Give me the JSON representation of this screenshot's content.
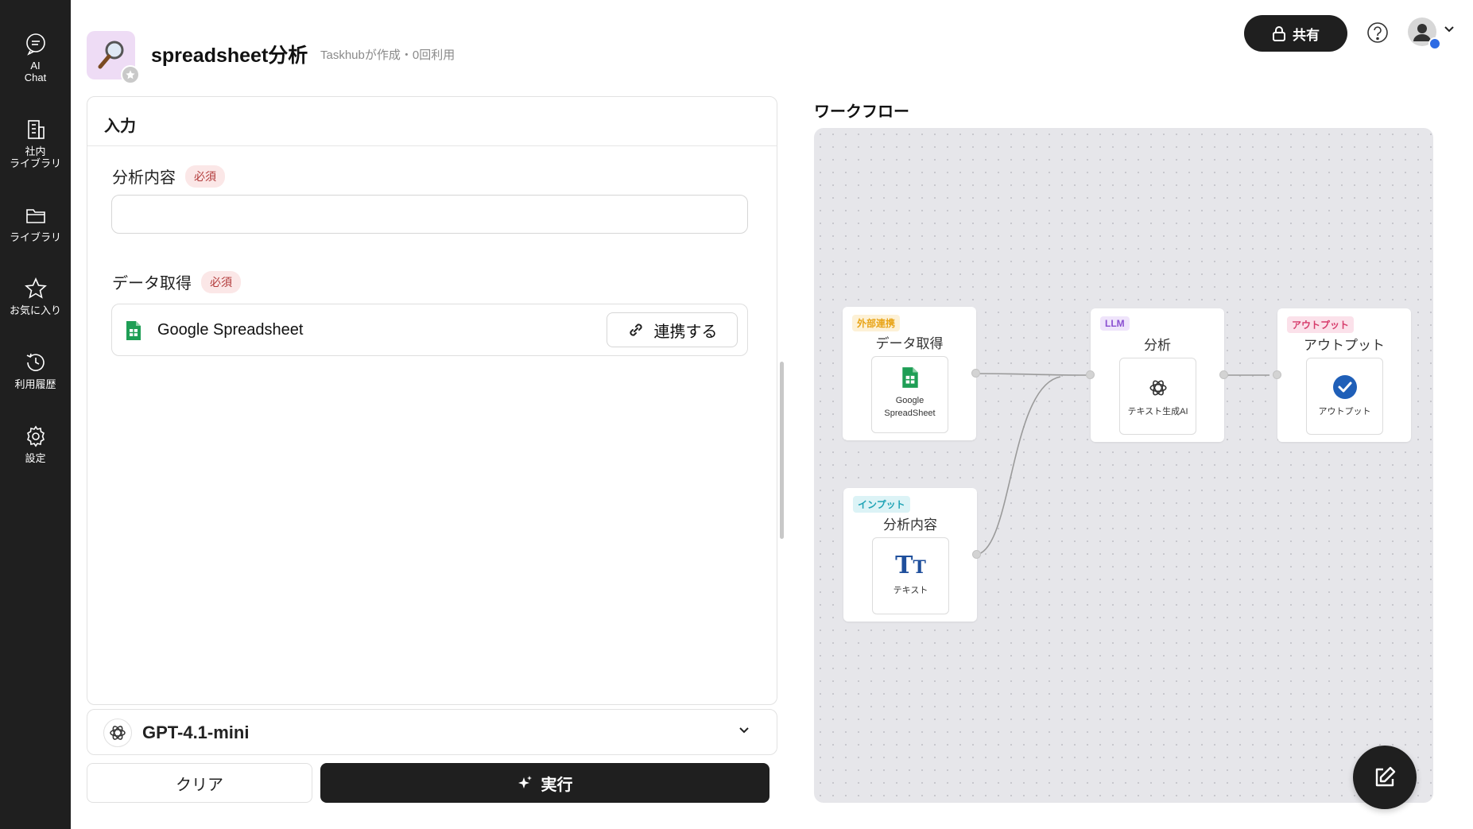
{
  "sidebar": {
    "items": [
      {
        "label": "AI\nChat",
        "icon": "chat-bubble-icon"
      },
      {
        "label": "社内\nライブラリ",
        "icon": "building-icon"
      },
      {
        "label": "ライブラリ",
        "icon": "folder-icon"
      },
      {
        "label": "お気に入り",
        "icon": "star-icon"
      },
      {
        "label": "利用履歴",
        "icon": "history-icon"
      },
      {
        "label": "設定",
        "icon": "gear-icon"
      }
    ]
  },
  "header": {
    "title": "spreadsheet分析",
    "subtitle": "Taskhubが作成・0回利用",
    "share_label": "共有"
  },
  "input_panel": {
    "title": "入力",
    "fields": [
      {
        "label": "分析内容",
        "required": "必須",
        "value": "",
        "placeholder": ""
      },
      {
        "label": "データ取得",
        "required": "必須",
        "source_name": "Google Spreadsheet",
        "connect_label": "連携する"
      }
    ]
  },
  "model": {
    "name": "GPT-4.1-mini"
  },
  "actions": {
    "clear_label": "クリア",
    "run_label": "実行"
  },
  "workflow": {
    "title": "ワークフロー",
    "nodes": [
      {
        "tag": "外部連携",
        "title": "データ取得",
        "card": "Google\nSpreadSheet"
      },
      {
        "tag": "インプット",
        "title": "分析内容",
        "card": "テキスト"
      },
      {
        "tag": "LLM",
        "title": "分析",
        "card": "テキスト生成AI"
      },
      {
        "tag": "アウトプット",
        "title": "アウトプット",
        "card": "アウトプット"
      }
    ]
  },
  "colors": {
    "sidebar_bg": "#1f1f1f",
    "accent_dark": "#1f1f1f",
    "required_text": "#b23a3a",
    "required_bg": "#fbe7e7",
    "tag_external": "#e8a417",
    "tag_input": "#1fa3b5",
    "tag_llm": "#8a4fd1",
    "tag_output": "#d63b6b",
    "sheets_green": "#1e9e55",
    "output_check": "#1f5fb8"
  }
}
